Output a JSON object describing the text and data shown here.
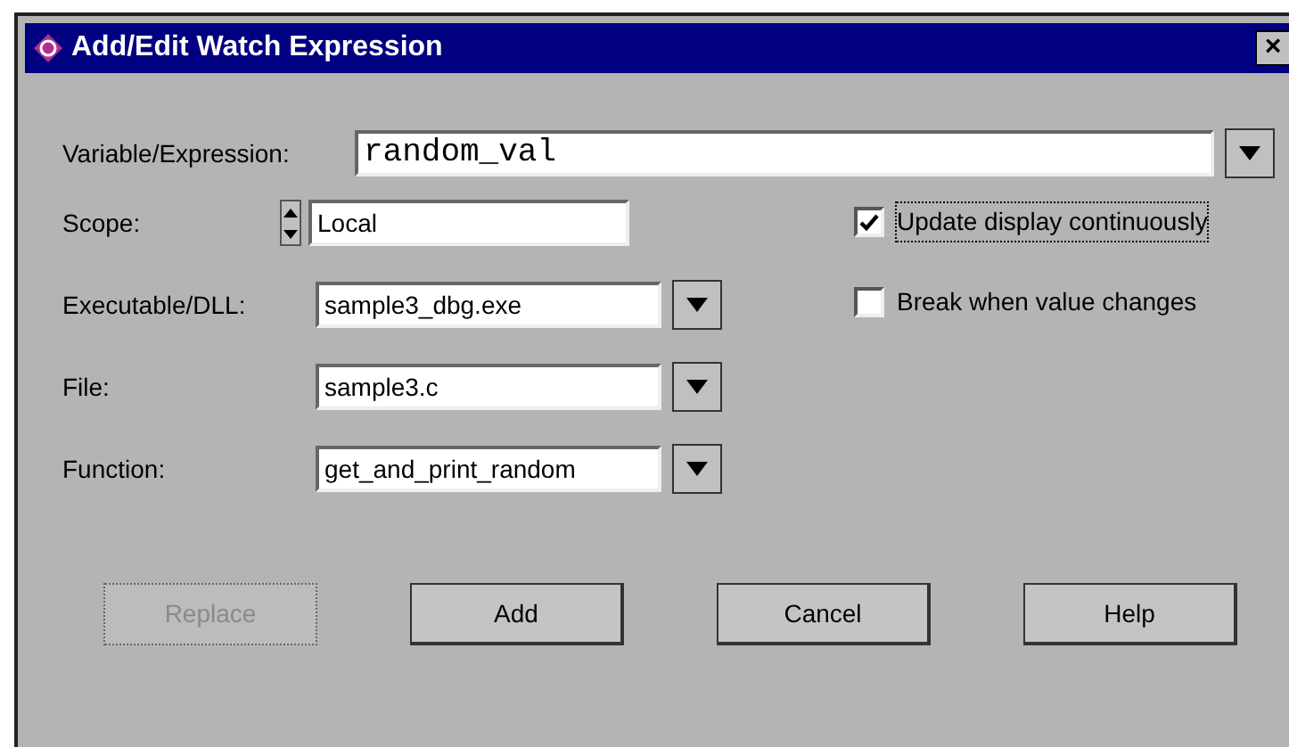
{
  "window": {
    "title": "Add/Edit Watch Expression",
    "close": "×"
  },
  "expression": {
    "label": "Variable/Expression:",
    "value": "random_val"
  },
  "fields": [
    {
      "kind": "spinner",
      "label": "Scope:",
      "value": "Local"
    },
    {
      "kind": "combo",
      "label": "Executable/DLL:",
      "value": "sample3_dbg.exe"
    },
    {
      "kind": "combo",
      "label": "File:",
      "value": "sample3.c"
    },
    {
      "kind": "combo",
      "label": "Function:",
      "value": "get_and_print_random"
    }
  ],
  "options": [
    {
      "label": "Update display continuously",
      "checked": true,
      "focused": true
    },
    {
      "label": "Break when value changes",
      "checked": false,
      "focused": false
    }
  ],
  "buttons": [
    {
      "label": "Replace",
      "disabled": true
    },
    {
      "label": "Add",
      "disabled": false
    },
    {
      "label": "Cancel",
      "disabled": false
    },
    {
      "label": "Help",
      "disabled": false
    }
  ]
}
